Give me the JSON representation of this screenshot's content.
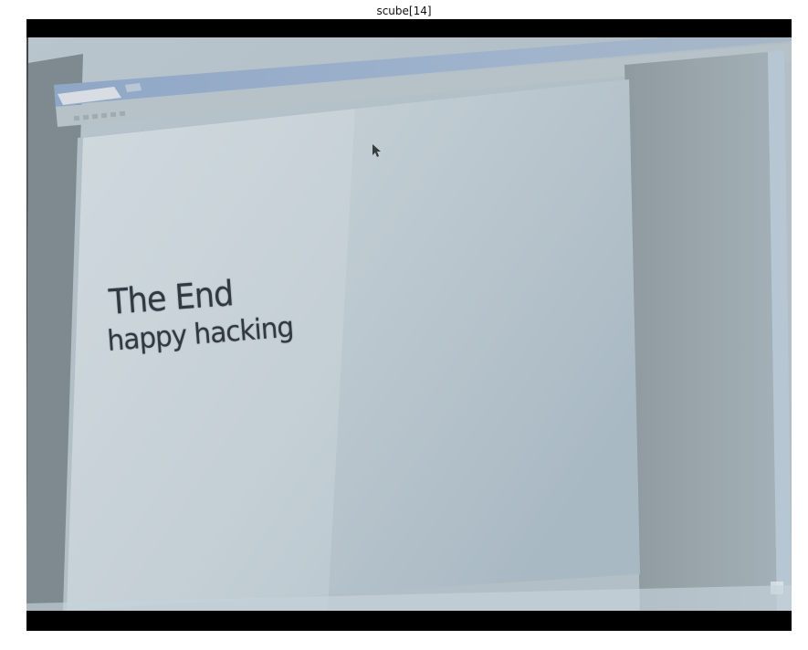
{
  "figure": {
    "title": "scube[14]"
  },
  "slide": {
    "heading": "The End",
    "subheading": "happy hacking"
  },
  "icons": {
    "pointer": "mouse-cursor-icon"
  },
  "colors": {
    "letterbox": "#000000",
    "slide_background": "#c9d2d8",
    "slide_text": "#303840"
  }
}
